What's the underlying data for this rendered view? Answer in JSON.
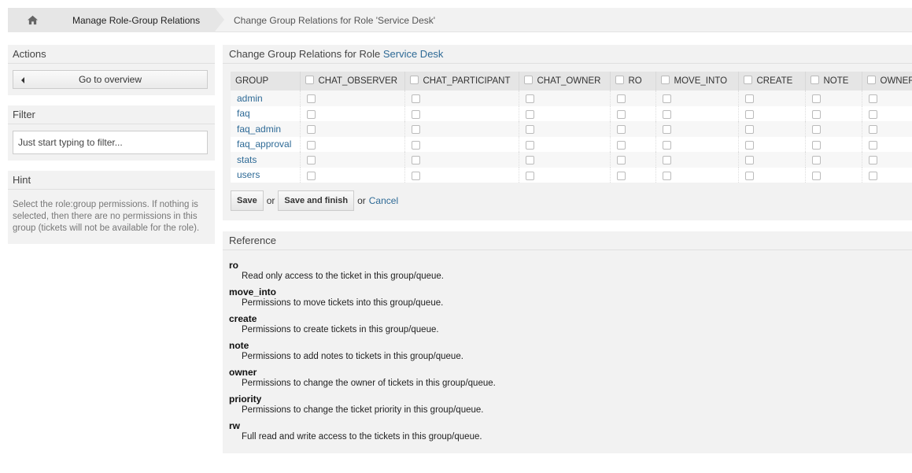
{
  "breadcrumb": {
    "home_icon": "home-icon",
    "items": [
      "Manage Role-Group Relations",
      "Change Group Relations for Role 'Service Desk'"
    ]
  },
  "sidebar": {
    "actions": {
      "title": "Actions",
      "overview_button": "Go to overview"
    },
    "filter": {
      "title": "Filter",
      "placeholder": "Just start typing to filter..."
    },
    "hint": {
      "title": "Hint",
      "text": "Select the role:group permissions. If nothing is selected, then there are no permissions in this group (tickets will not be available for the role)."
    }
  },
  "main": {
    "title_prefix": "Change Group Relations for Role ",
    "role_name": "Service Desk",
    "table": {
      "group_header": "GROUP",
      "permissions": [
        "CHAT_OBSERVER",
        "CHAT_PARTICIPANT",
        "CHAT_OWNER",
        "RO",
        "MOVE_INTO",
        "CREATE",
        "NOTE",
        "OWNER"
      ],
      "groups": [
        "admin",
        "faq",
        "faq_admin",
        "faq_approval",
        "stats",
        "users"
      ]
    },
    "actions": {
      "save": "Save",
      "or1": "or",
      "save_finish": "Save and finish",
      "or2": "or",
      "cancel": "Cancel"
    }
  },
  "reference": {
    "title": "Reference",
    "items": [
      {
        "term": "ro",
        "desc": "Read only access to the ticket in this group/queue."
      },
      {
        "term": "move_into",
        "desc": "Permissions to move tickets into this group/queue."
      },
      {
        "term": "create",
        "desc": "Permissions to create tickets in this group/queue."
      },
      {
        "term": "note",
        "desc": "Permissions to add notes to tickets in this group/queue."
      },
      {
        "term": "owner",
        "desc": "Permissions to change the owner of tickets in this group/queue."
      },
      {
        "term": "priority",
        "desc": "Permissions to change the ticket priority in this group/queue."
      },
      {
        "term": "rw",
        "desc": "Full read and write access to the tickets in this group/queue."
      }
    ]
  },
  "colors": {
    "link": "#2e6a96",
    "panel": "#f2f2f2"
  }
}
